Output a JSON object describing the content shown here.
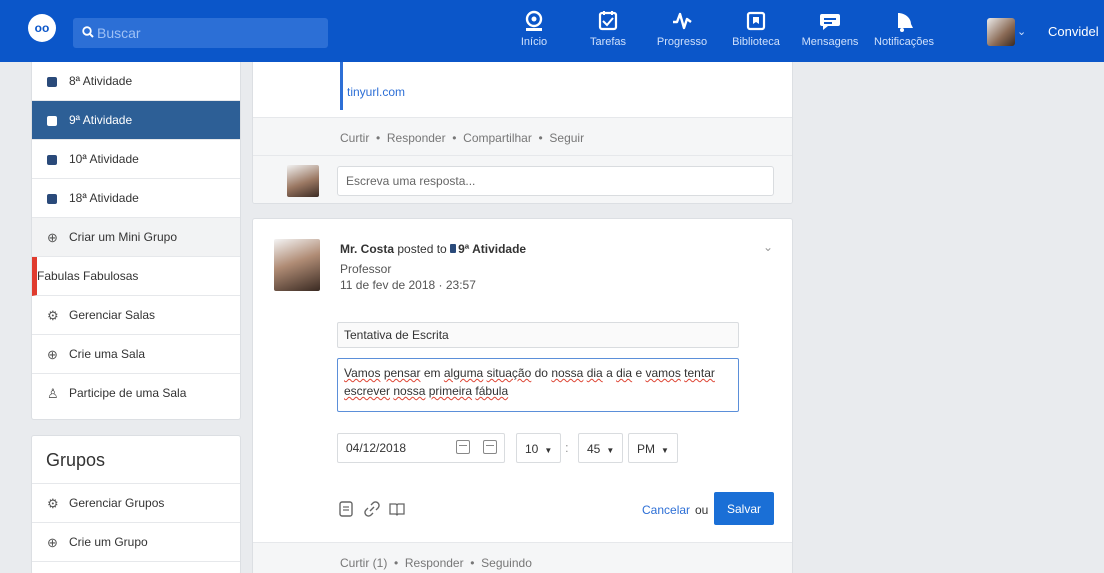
{
  "header": {
    "logo": "oo",
    "search_placeholder": "Buscar",
    "nav": [
      {
        "label": "Início",
        "icon": "home-icon"
      },
      {
        "label": "Tarefas",
        "icon": "tasks-icon"
      },
      {
        "label": "Progresso",
        "icon": "pulse-icon"
      },
      {
        "label": "Biblioteca",
        "icon": "library-icon"
      },
      {
        "label": "Mensagens",
        "icon": "message-icon"
      },
      {
        "label": "Notificações",
        "icon": "bell-icon"
      }
    ],
    "user_name": "Convidel"
  },
  "sidebar": {
    "activities": [
      {
        "label": "8ª Atividade"
      },
      {
        "label": "9ª Atividade"
      },
      {
        "label": "10ª Atividade"
      },
      {
        "label": "18ª Atividade"
      }
    ],
    "create_mini_group": "Criar um Mini Grupo",
    "current_group": "Fabulas Fabulosas",
    "manage_rooms": "Gerenciar Salas",
    "create_room": "Crie uma Sala",
    "join_room": "Participe de uma Sala",
    "groups_title": "Grupos",
    "manage_groups": "Gerenciar Grupos",
    "create_group": "Crie um Grupo"
  },
  "post1": {
    "link": "tinyurl.com",
    "actions": {
      "like": "Curtir",
      "reply": "Responder",
      "share": "Compartilhar",
      "follow": "Seguir"
    },
    "reply_placeholder": "Escreva uma resposta..."
  },
  "post2": {
    "author": "Mr. Costa",
    "posted_to": "posted to",
    "group": "9ª Atividade",
    "role": "Professor",
    "date": "11 de fev de 2018 · 23:57",
    "title_value": "Tentativa de Escrita",
    "body_words": [
      "Vamos",
      "pensar",
      "em",
      "alguma",
      "situação",
      "do",
      "nossa",
      "dia",
      "a",
      "dia",
      "e",
      "vamos",
      "tentar",
      "escrever",
      "nossa",
      "primeira",
      "fábula"
    ],
    "due_date": "04/12/2018",
    "hour": "10",
    "minute": "45",
    "ampm": "PM",
    "colon": ":",
    "cancel": "Cancelar",
    "or": "ou",
    "save": "Salvar",
    "actions": {
      "like": "Curtir (1)",
      "reply": "Responder",
      "following": "Seguindo"
    }
  }
}
